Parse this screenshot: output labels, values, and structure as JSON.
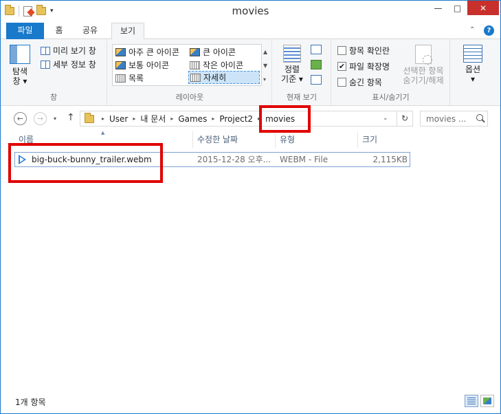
{
  "window": {
    "title": "movies",
    "controls": {
      "minimize": "—",
      "maximize": "□",
      "close": "✕"
    }
  },
  "quick_access": {
    "dropdown": "▾"
  },
  "tabs": {
    "file": "파일",
    "home": "홈",
    "share": "공유",
    "view": "보기"
  },
  "ribbon_toggle": "⌃",
  "help": "?",
  "ribbon": {
    "pane": {
      "nav_pane_line1": "탐색",
      "nav_pane_line2": "창 ▾",
      "preview": "미리 보기 창",
      "details": "세부 정보 창",
      "label": "창"
    },
    "layout": {
      "items": [
        "아주 큰 아이콘",
        "큰 아이콘",
        "보통 아이콘",
        "작은 아이콘",
        "목록",
        "자세히"
      ],
      "selected": "자세히",
      "label": "레이아웃"
    },
    "current_view": {
      "sort_line1": "정렬",
      "sort_line2": "기준 ▾",
      "label": "현재 보기"
    },
    "show_hide": {
      "item_checkboxes": {
        "label": "항목 확인란",
        "checked": false
      },
      "file_extensions": {
        "label": "파일 확장명",
        "checked": true
      },
      "hidden_items": {
        "label": "숨긴 항목",
        "checked": false
      },
      "hide_selected_line1": "선택한 항목",
      "hide_selected_line2": "숨기기/해제",
      "label": "표시/숨기기"
    },
    "options": {
      "label_line1": "옵션",
      "label_line2": "▾"
    }
  },
  "navigation": {
    "back": "←",
    "forward": "→",
    "recent": "▾",
    "up": "↑",
    "breadcrumbs": [
      "User",
      "내 문서",
      "Games",
      "Project2",
      "movies"
    ],
    "separator": "▸",
    "dropdown": "⌄",
    "refresh": "↻",
    "search_placeholder": "movies ..."
  },
  "columns": {
    "name": "이름",
    "date": "수정한 날짜",
    "type": "유형",
    "size": "크기",
    "sort_indicator": "▲"
  },
  "files": [
    {
      "name": "big-buck-bunny_trailer.webm",
      "date": "2015-12-28 오후...",
      "type": "WEBM - File",
      "size": "2,115KB"
    }
  ],
  "status": {
    "item_count": "1개 항목"
  },
  "colors": {
    "accent": "#1979ca",
    "close": "#c7302b",
    "highlight": "#e00000"
  }
}
